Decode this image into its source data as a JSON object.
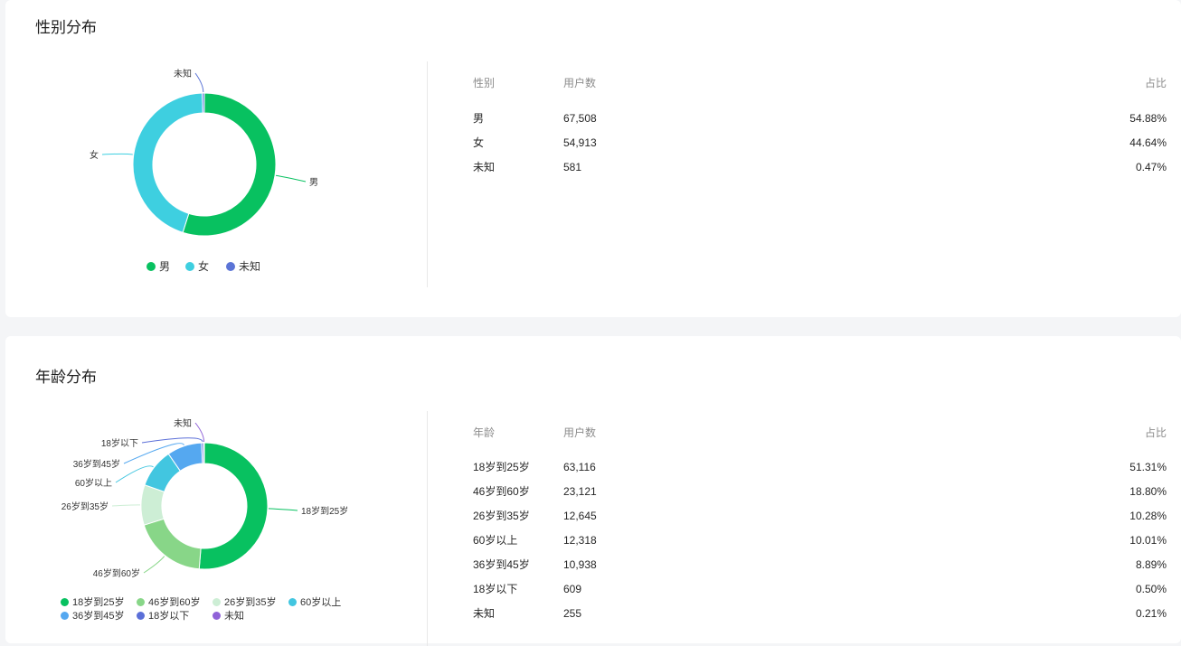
{
  "colors": {
    "male": "#08c160",
    "female": "#3ecfe0",
    "unknown": "#5b74d6",
    "age_18_25": "#08c160",
    "age_46_60": "#88d688",
    "age_26_35": "#cdeed5",
    "age_60_plus": "#42c6e0",
    "age_36_45": "#55a8f0",
    "age_under_18": "#5b6fd8",
    "age_unknown": "#9062d8"
  },
  "gender_section": {
    "title": "性别分布",
    "table_headers": [
      "性别",
      "用户数",
      "占比"
    ],
    "rows": [
      {
        "label": "男",
        "count": "67,508",
        "pct": "54.88%"
      },
      {
        "label": "女",
        "count": "54,913",
        "pct": "44.64%"
      },
      {
        "label": "未知",
        "count": "581",
        "pct": "0.47%"
      }
    ],
    "legend": [
      "男",
      "女",
      "未知"
    ]
  },
  "age_section": {
    "title": "年龄分布",
    "table_headers": [
      "年龄",
      "用户数",
      "占比"
    ],
    "rows": [
      {
        "label": "18岁到25岁",
        "count": "63,116",
        "pct": "51.31%"
      },
      {
        "label": "46岁到60岁",
        "count": "23,121",
        "pct": "18.80%"
      },
      {
        "label": "26岁到35岁",
        "count": "12,645",
        "pct": "10.28%"
      },
      {
        "label": "60岁以上",
        "count": "12,318",
        "pct": "10.01%"
      },
      {
        "label": "36岁到45岁",
        "count": "10,938",
        "pct": "8.89%"
      },
      {
        "label": "18岁以下",
        "count": "609",
        "pct": "0.50%"
      },
      {
        "label": "未知",
        "count": "255",
        "pct": "0.21%"
      }
    ],
    "legend": [
      "18岁到25岁",
      "46岁到60岁",
      "26岁到35岁",
      "60岁以上",
      "36岁到45岁",
      "18岁以下",
      "未知"
    ]
  },
  "chart_data": [
    {
      "type": "pie",
      "categories": [
        "男",
        "女",
        "未知"
      ],
      "values": [
        67508,
        54913,
        581
      ],
      "legend": "bottom"
    },
    {
      "type": "pie",
      "categories": [
        "18岁到25岁",
        "46岁到60岁",
        "26岁到35岁",
        "60岁以上",
        "36岁到45岁",
        "18岁以下",
        "未知"
      ],
      "values": [
        63116,
        23121,
        12645,
        12318,
        10938,
        609,
        255
      ],
      "legend": "bottom"
    }
  ]
}
